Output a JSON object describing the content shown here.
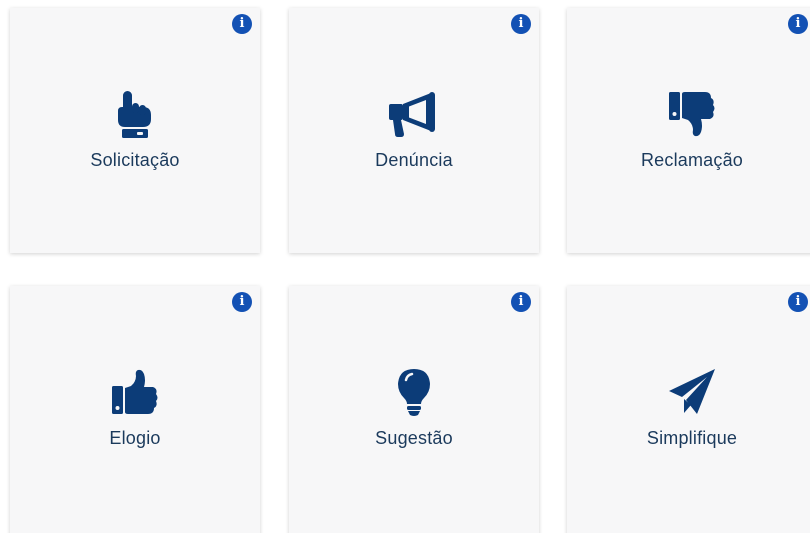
{
  "colors": {
    "icon": "#0c3c78",
    "info": "#1351b4",
    "card_bg": "#f7f7f8",
    "label": "#1b3a5c"
  },
  "info_glyph": "i",
  "cards": [
    {
      "label": "Solicitação",
      "icon": "pointing-hand-icon"
    },
    {
      "label": "Denúncia",
      "icon": "megaphone-icon"
    },
    {
      "label": "Reclamação",
      "icon": "thumbs-down-icon"
    },
    {
      "label": "Elogio",
      "icon": "thumbs-up-icon"
    },
    {
      "label": "Sugestão",
      "icon": "lightbulb-icon"
    },
    {
      "label": "Simplifique",
      "icon": "paper-plane-icon"
    }
  ]
}
